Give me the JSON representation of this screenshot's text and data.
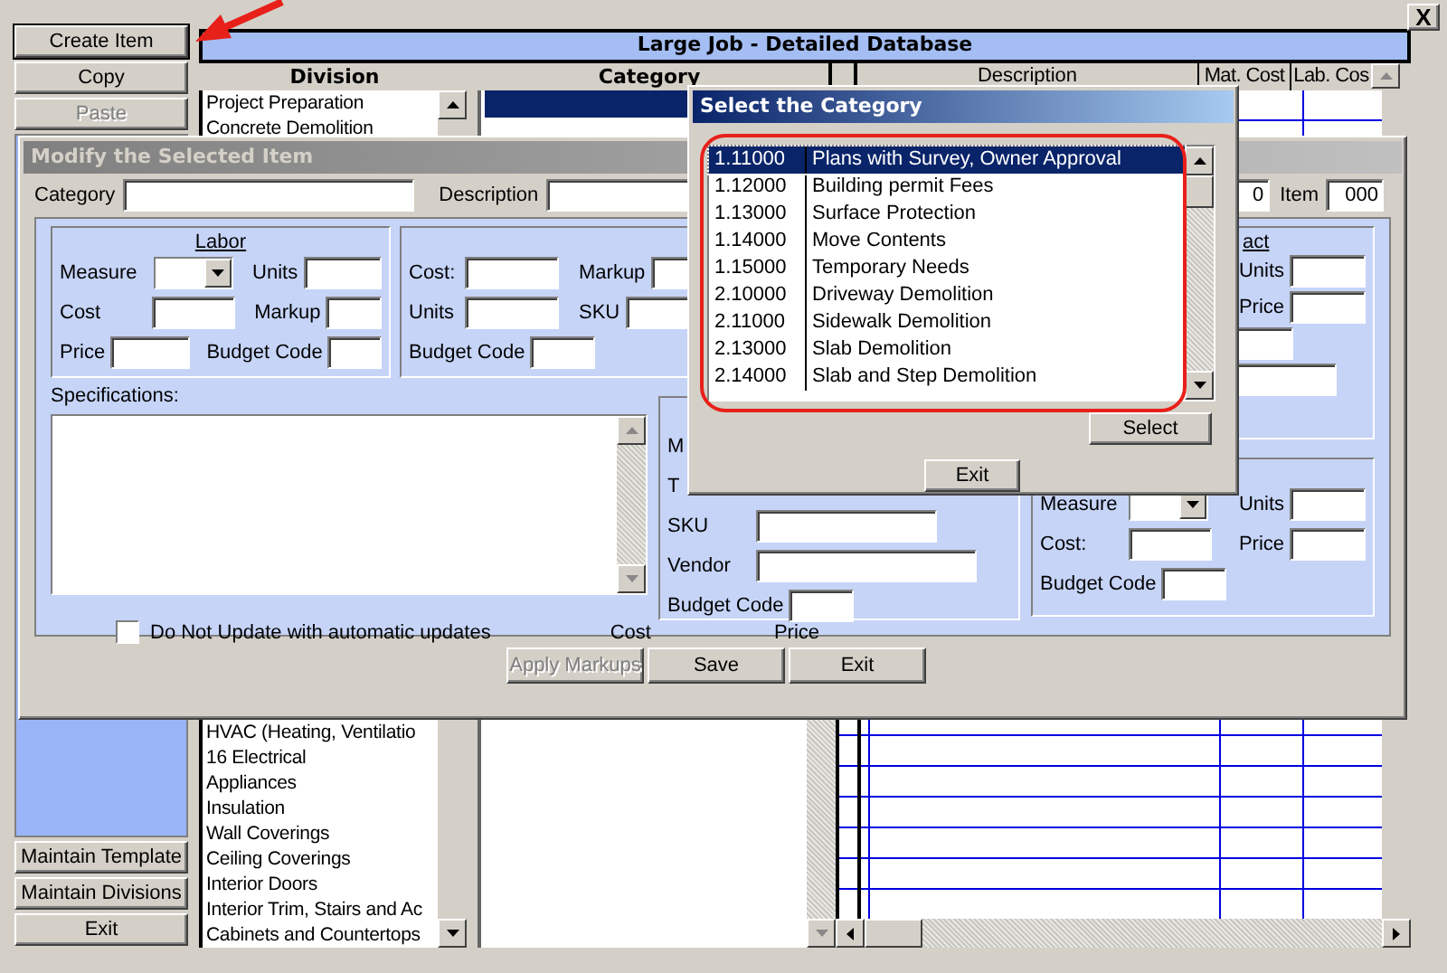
{
  "window": {
    "close": "X",
    "title": "Large Job - Detailed Database"
  },
  "side_buttons_top": [
    {
      "label": "Create Item",
      "default": true,
      "disabled": false
    },
    {
      "label": "Copy",
      "default": false,
      "disabled": false
    },
    {
      "label": "Paste",
      "default": false,
      "disabled": true
    }
  ],
  "side_buttons_bottom": [
    {
      "label": "Maintain Template"
    },
    {
      "label": "Maintain Divisions"
    },
    {
      "label": "Exit"
    }
  ],
  "columns": {
    "division": "Division",
    "category": "Category",
    "description": "Description",
    "mat_cost": "Mat. Cost",
    "lab_cost": "Lab. Cos"
  },
  "divisions_top": [
    "Project Preparation",
    "Concrete Demolition"
  ],
  "divisions_bottom": [
    "HVAC (Heating, Ventilatio",
    "16 Electrical",
    "Appliances",
    "Insulation",
    "Wall Coverings",
    "Ceiling Coverings",
    "Interior Doors",
    "Interior Trim, Stairs and Ac",
    "Cabinets and Countertops"
  ],
  "category_rows": [
    {
      "selected": true
    }
  ],
  "modify_dialog": {
    "title": "Modify the Selected Item",
    "active": false,
    "category_label": "Category",
    "description_label": "Description",
    "number_value": "0",
    "item_label": "Item",
    "item_value": "000",
    "labor": {
      "title": "Labor",
      "measure": "Measure",
      "units": "Units",
      "cost": "Cost",
      "markup": "Markup",
      "price": "Price",
      "budget_code": "Budget Code"
    },
    "material": {
      "cost": "Cost:",
      "markup": "Markup",
      "units": "Units",
      "sku": "SKU",
      "budget_code": "Budget Code"
    },
    "subcontract": {
      "title": "act",
      "units": "Units",
      "price": "Price"
    },
    "specifications_label": "Specifications:",
    "vendor_group": {
      "m": "M",
      "t": "T",
      "sku": "SKU",
      "vendor": "Vendor",
      "budget_code": "Budget Code"
    },
    "lower_right": {
      "measure": "Measure",
      "units": "Units",
      "cost": "Cost:",
      "price": "Price",
      "budget_code": "Budget Code"
    },
    "no_update": {
      "label": "Do Not Update with automatic updates",
      "checked": false
    },
    "footer_labels": [
      "Cost",
      "Price"
    ],
    "buttons": [
      {
        "label": "Apply Markups",
        "disabled": true
      },
      {
        "label": "Save",
        "disabled": false
      },
      {
        "label": "Exit",
        "disabled": false
      }
    ]
  },
  "select_dialog": {
    "title": "Select the Category",
    "active": true,
    "items": [
      {
        "code": "1.11000",
        "name": "Plans with Survey, Owner Approval",
        "selected": true
      },
      {
        "code": "1.12000",
        "name": "Building permit Fees",
        "selected": false
      },
      {
        "code": "1.13000",
        "name": "Surface Protection",
        "selected": false
      },
      {
        "code": "1.14000",
        "name": "Move Contents",
        "selected": false
      },
      {
        "code": "1.15000",
        "name": "Temporary Needs",
        "selected": false
      },
      {
        "code": "2.10000",
        "name": "Driveway Demolition",
        "selected": false
      },
      {
        "code": "2.11000",
        "name": "Sidewalk Demolition",
        "selected": false
      },
      {
        "code": "2.13000",
        "name": "Slab Demolition",
        "selected": false
      },
      {
        "code": "2.14000",
        "name": "Slab and Step Demolition",
        "selected": false
      }
    ],
    "select_button": "Select",
    "exit_button": "Exit"
  }
}
